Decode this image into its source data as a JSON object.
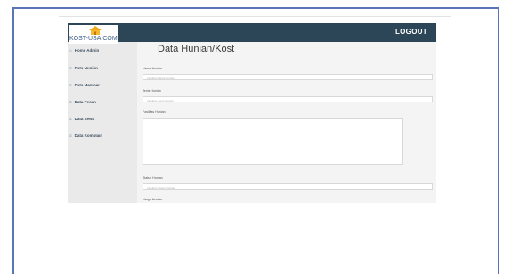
{
  "header": {
    "logout_label": "LOGOUT"
  },
  "logo": {
    "text": "KOST-USA.COM"
  },
  "sidebar": {
    "items": [
      {
        "icon": "home-icon",
        "label": "Home Admin"
      },
      {
        "icon": "list-icon",
        "label": "Data Hunian"
      },
      {
        "icon": "list-icon",
        "label": "Data Member"
      },
      {
        "icon": "list-icon",
        "label": "Data Pesan"
      },
      {
        "icon": "list-icon",
        "label": "Data Sewa"
      },
      {
        "icon": "list-icon",
        "label": "Data Komplain"
      }
    ]
  },
  "main": {
    "title": "Data Hunian/Kost",
    "fields": {
      "nama": {
        "label": "Nama Hunian",
        "placeholder": "Inputkan Nama Hunian"
      },
      "jenis": {
        "label": "Jenis Hunian",
        "placeholder": "Inputkan Jenis Hunian"
      },
      "fasilitas": {
        "label": "Fasilitas Hunian"
      },
      "status": {
        "label": "Status Hunian",
        "placeholder": "Inputkan Status Hunian"
      },
      "harga": {
        "label": "Harga Hunian"
      }
    }
  },
  "colors": {
    "topbar": "#2c4658",
    "sidebar": "#eaeaea",
    "frame": "#5a74b8",
    "logo_house": "#f0a818"
  }
}
